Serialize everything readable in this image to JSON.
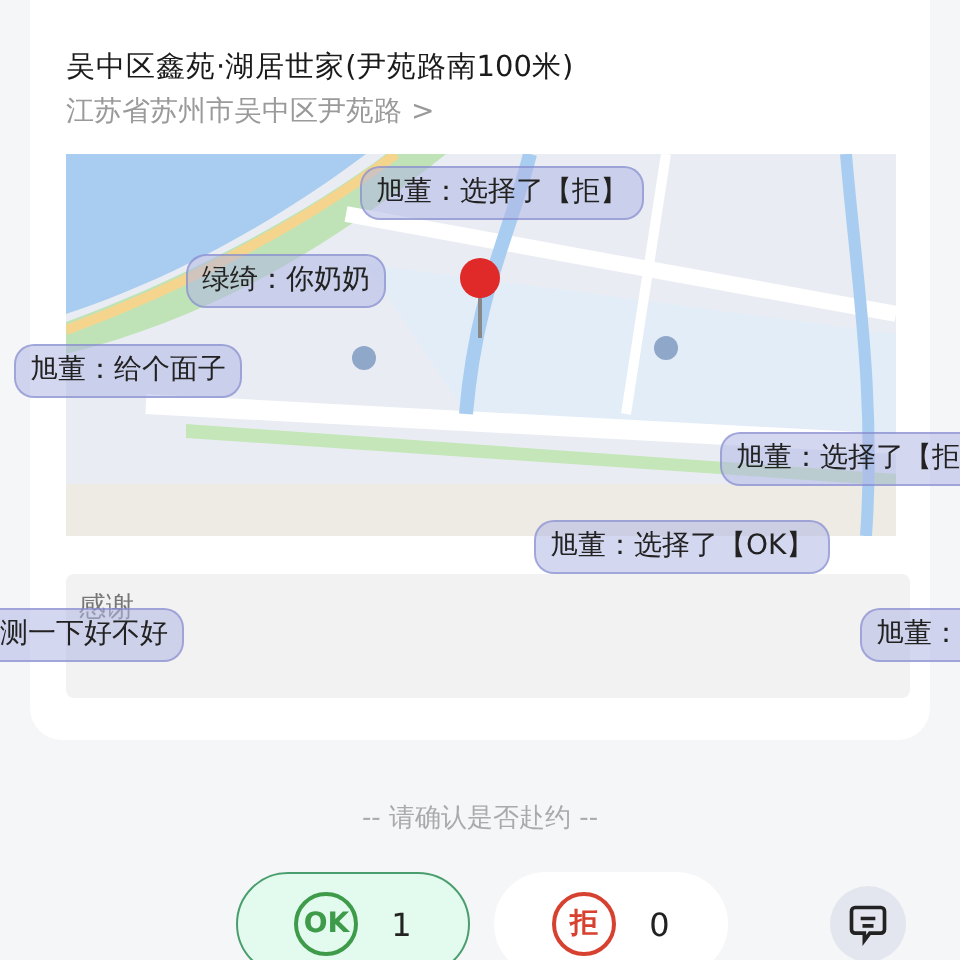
{
  "location": {
    "title": "吴中区鑫苑·湖居世家(尹苑路南100米)",
    "address": "江苏省苏州市吴中区尹苑路 >"
  },
  "remark": "感谢",
  "prompt": "-- 请确认是否赴约 --",
  "options": [
    {
      "kind": "ok",
      "label": "OK",
      "count": "1",
      "selected": true
    },
    {
      "kind": "reject",
      "label": "拒",
      "count": "0",
      "selected": false
    }
  ],
  "danmaku": [
    {
      "text": "旭董：选择了【拒】"
    },
    {
      "text": "绿绮：你奶奶"
    },
    {
      "text": "旭董：给个面子"
    },
    {
      "text": "旭董：选择了【拒"
    },
    {
      "text": "旭董：选择了【OK】"
    },
    {
      "text": "测一下好不好"
    },
    {
      "text": "旭董："
    }
  ]
}
